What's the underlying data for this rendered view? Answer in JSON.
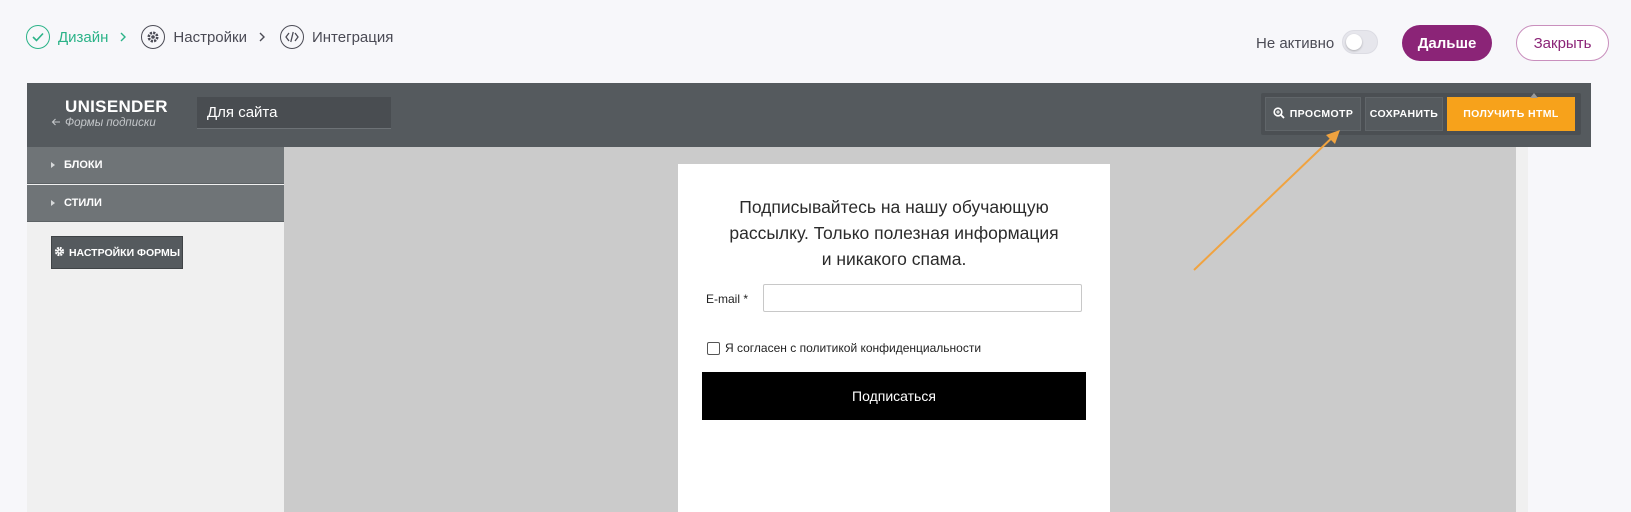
{
  "steps": [
    {
      "label": "Дизайн",
      "state": "done",
      "icon": "check-icon"
    },
    {
      "label": "Настройки",
      "state": "pending",
      "icon": "gear-icon"
    },
    {
      "label": "Интеграция",
      "state": "pending",
      "icon": "code-icon"
    }
  ],
  "status": {
    "label": "Не активно",
    "active": false
  },
  "actions": {
    "next_label": "Дальше",
    "close_label": "Закрыть"
  },
  "editor": {
    "brand": "UNISENDER",
    "back_link": "Формы подписки",
    "form_name": "Для сайта",
    "toolbar": {
      "preview": "ПРОСМОТР",
      "save": "СОХРАНИТЬ",
      "get_html": "ПОЛУЧИТЬ HTML"
    },
    "sidebar": {
      "blocks": "БЛОКИ",
      "styles": "СТИЛИ",
      "form_settings": "НАСТРОЙКИ ФОРМЫ"
    }
  },
  "form": {
    "title_lines": [
      "Подписывайтесь на нашу обучающую",
      "рассылку. Только полезная информация",
      "и никакого спама."
    ],
    "email_label": "E-mail *",
    "email_value": "",
    "consent_label": "Я согласен с политикой конфиденциальности",
    "consent_checked": false,
    "submit_label": "Подписаться"
  },
  "colors": {
    "accent": "#2bb388",
    "brand": "#8b2477",
    "highlight": "#f7a21b",
    "annotation_arrow": "#f0a340"
  }
}
